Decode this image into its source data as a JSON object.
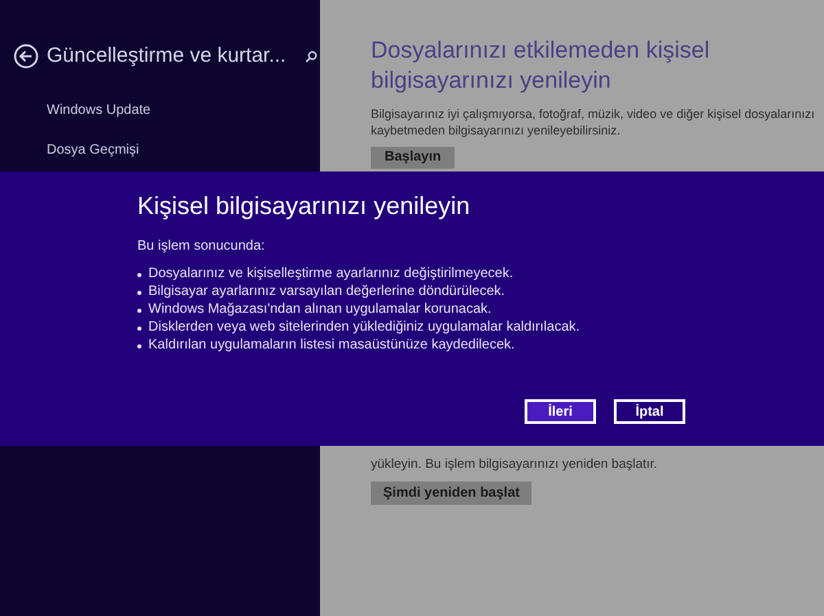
{
  "sidebar": {
    "title": "Güncelleştirme ve kurtar...",
    "items": [
      {
        "label": "Windows Update",
        "selected": false
      },
      {
        "label": "Dosya Geçmişi",
        "selected": false
      }
    ]
  },
  "content": {
    "heading": "Dosyalarınızı etkilemeden kişisel bilgisayarınızı yenileyin",
    "description": "Bilgisayarınız iyi çalışmıyorsa, fotoğraf, müzik, video ve diğer kişisel dosyalarınızı kaybetmeden bilgisayarınızı yenileyebilirsiniz.",
    "button": "Başlayın",
    "lower_text": "yükleyin. Bu işlem bilgisayarınızı yeniden başlatır.",
    "lower_button": "Şimdi yeniden başlat"
  },
  "dialog": {
    "title": "Kişisel bilgisayarınızı yenileyin",
    "intro": "Bu işlem sonucunda:",
    "bullets": [
      "Dosyalarınız ve kişiselleştirme ayarlarınız değiştirilmeyecek.",
      "Bilgisayar ayarlarınız varsayılan değerlerine döndürülecek.",
      "Windows Mağazası'ndan alınan uygulamalar korunacak.",
      "Disklerden veya web sitelerinden yüklediğiniz uygulamalar kaldırılacak.",
      "Kaldırılan uygulamaların listesi masaüstünüze kaydedilecek."
    ],
    "buttons": [
      {
        "label": "İleri",
        "kind": "primary"
      },
      {
        "label": "İptal",
        "kind": "secondary"
      }
    ]
  }
}
